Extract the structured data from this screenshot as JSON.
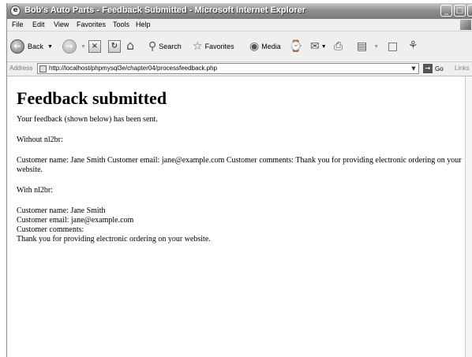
{
  "window": {
    "title": "Bob's Auto Parts - Feedback Submitted - Microsoft Internet Explorer"
  },
  "menu": [
    "File",
    "Edit",
    "View",
    "Favorites",
    "Tools",
    "Help"
  ],
  "toolbar": {
    "back_label": "Back",
    "search_label": "Search",
    "favorites_label": "Favorites",
    "media_label": "Media"
  },
  "address": {
    "label": "Address",
    "url": "http://localhost/phpmysql3e/chapter04/processfeedback.php",
    "go_label": "Go",
    "links_label": "Links"
  },
  "page": {
    "heading": "Feedback submitted",
    "intro": "Your feedback (shown below) has been sent.",
    "without_label": "Without nl2br:",
    "without_text": "Customer name: Jane Smith Customer email: jane@example.com Customer comments: Thank you for providing electronic ordering on your website.",
    "with_label": "With nl2br:",
    "with_lines": [
      "Customer name: Jane Smith",
      "Customer email: jane@example.com",
      "Customer comments:",
      "Thank you for providing electronic ordering on your website."
    ]
  },
  "icons": {
    "back": "back-arrow-icon",
    "forward": "forward-arrow-icon",
    "stop": "stop-icon",
    "refresh": "refresh-icon",
    "home": "home-icon",
    "search": "search-icon",
    "favorites": "favorites-star-icon",
    "media": "media-icon",
    "history": "history-icon",
    "mail": "mail-icon",
    "print": "print-icon",
    "edit": "edit-icon",
    "discuss": "discuss-icon",
    "messenger": "messenger-icon"
  },
  "colors": {
    "titlebar": "#7a7a7a",
    "chrome": "#efefef",
    "content_bg": "#ffffff"
  }
}
